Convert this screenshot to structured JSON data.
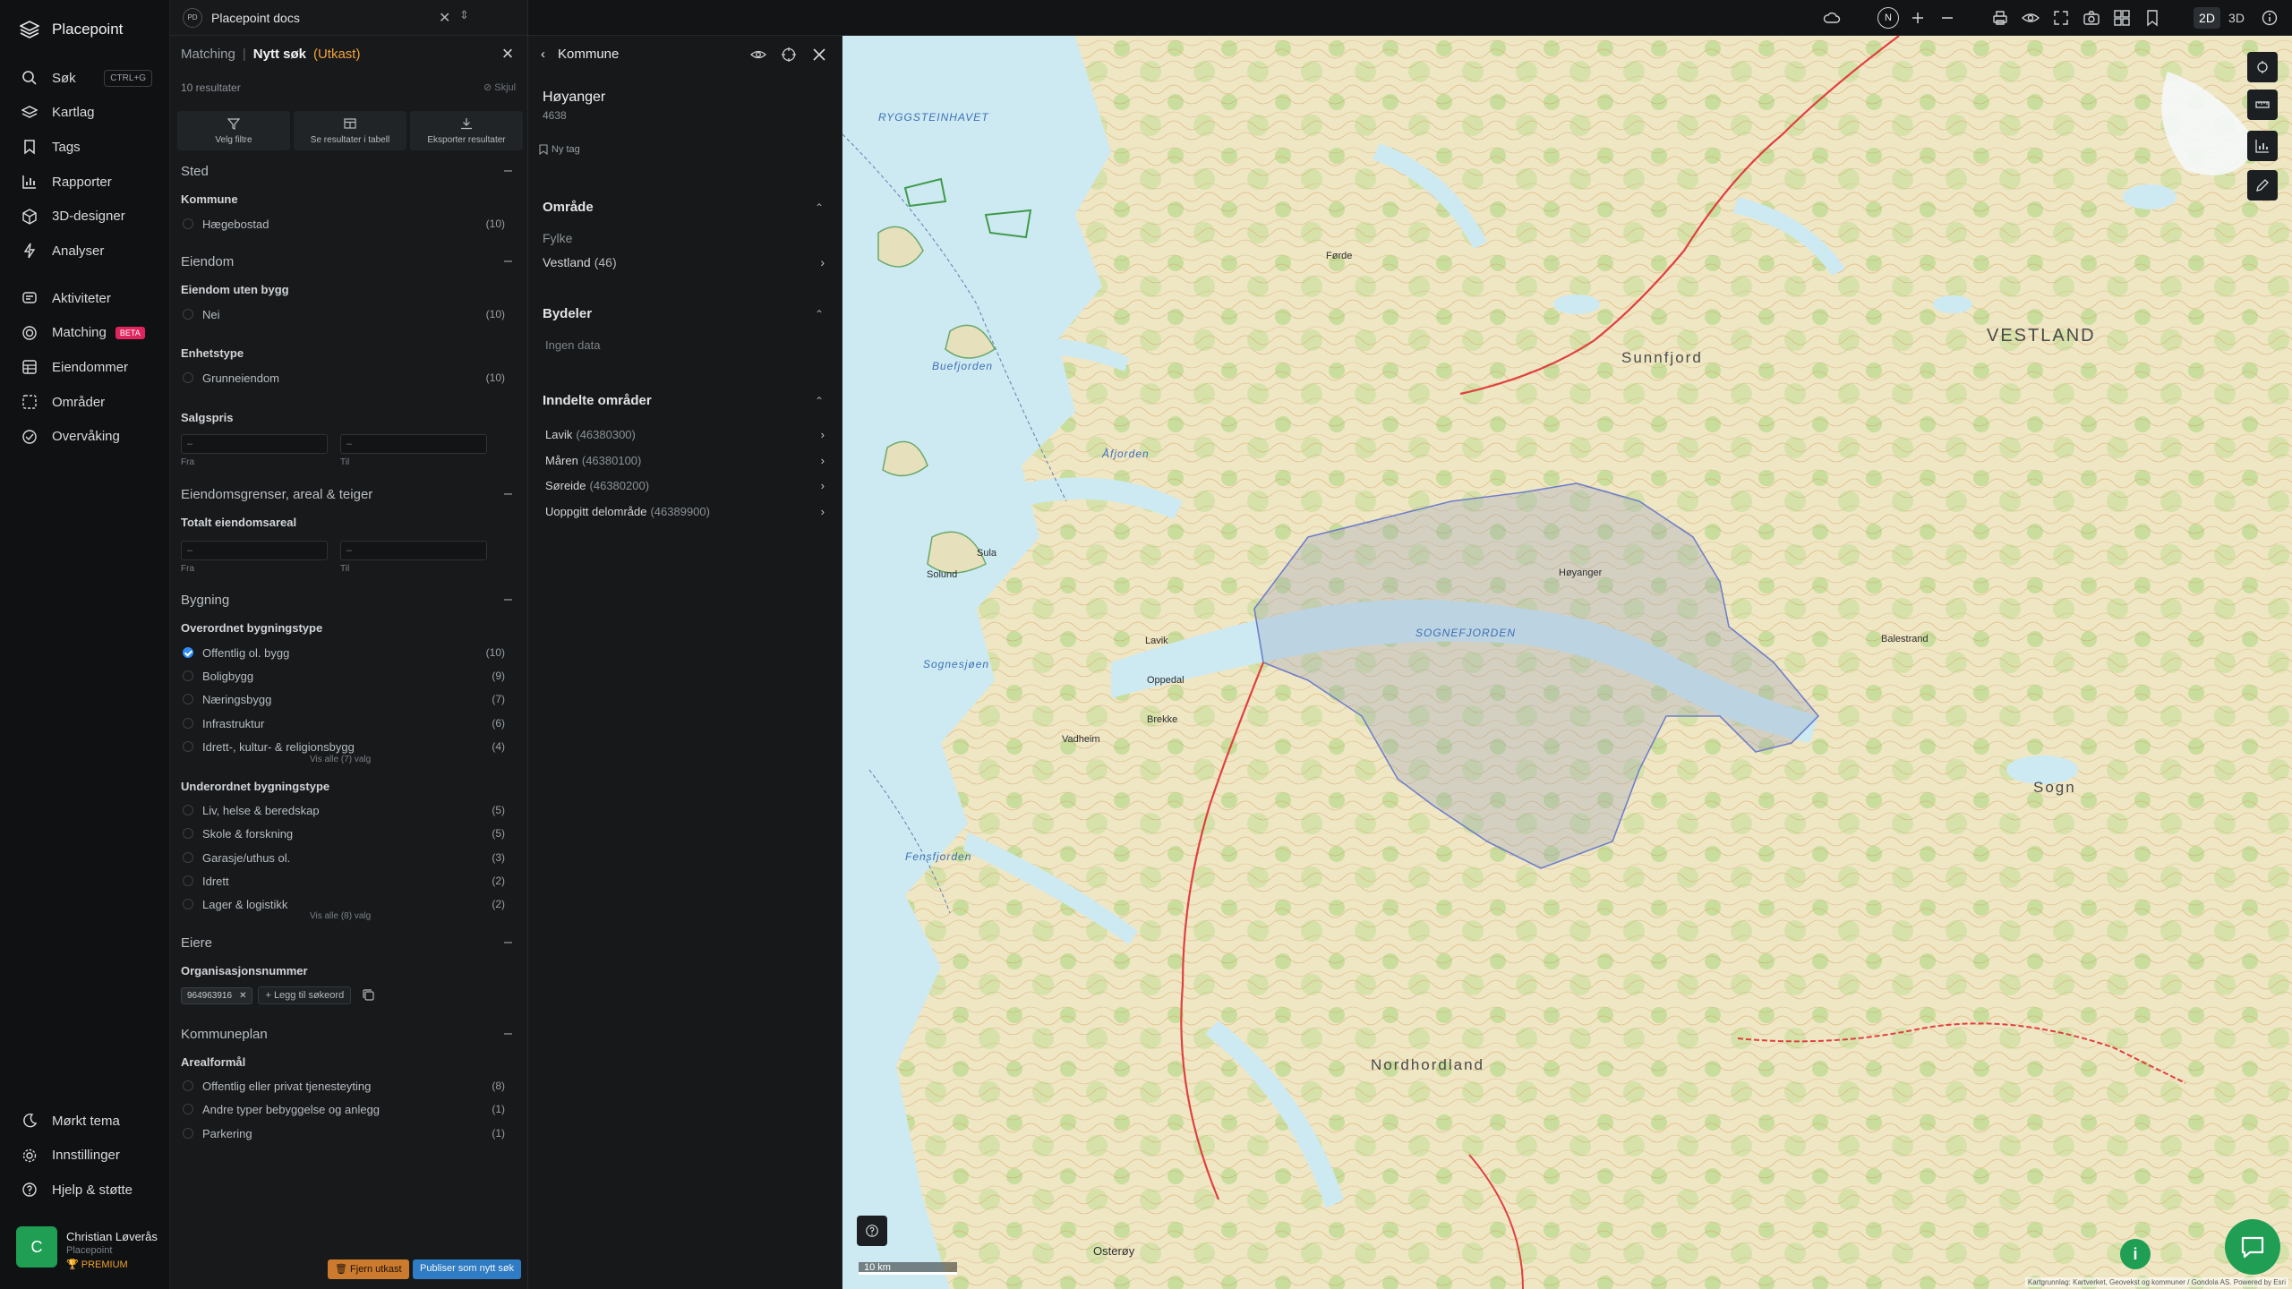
{
  "app": {
    "name": "Placepoint"
  },
  "nav": {
    "items": [
      {
        "label": "Søk",
        "icon": "search-icon",
        "shortcut": "CTRL+G"
      },
      {
        "label": "Kartlag",
        "icon": "layers-icon"
      },
      {
        "label": "Tags",
        "icon": "bookmark-icon"
      },
      {
        "label": "Rapporter",
        "icon": "chart-icon"
      },
      {
        "label": "3D-designer",
        "icon": "cube-icon"
      },
      {
        "label": "Analyser",
        "icon": "bolt-icon"
      }
    ],
    "items2": [
      {
        "label": "Aktiviteter",
        "icon": "activity-icon"
      },
      {
        "label": "Matching",
        "icon": "target-icon",
        "badge": "BETA"
      },
      {
        "label": "Eiendommer",
        "icon": "grid-icon"
      },
      {
        "label": "Områder",
        "icon": "area-icon"
      },
      {
        "label": "Overvåking",
        "icon": "monitor-icon"
      }
    ],
    "bottom": [
      {
        "label": "Mørkt tema",
        "icon": "moon-icon"
      },
      {
        "label": "Innstillinger",
        "icon": "gear-icon"
      },
      {
        "label": "Hjelp & støtte",
        "icon": "help-icon"
      }
    ],
    "user": {
      "initial": "C",
      "name": "Christian Løverås",
      "org": "Placepoint",
      "plan": "PREMIUM"
    }
  },
  "doc_tab": {
    "badge": "PD",
    "title": "Placepoint docs"
  },
  "search_panel": {
    "crumb_parent": "Matching",
    "crumb_sep": "|",
    "title": "Nytt søk",
    "state": "(Utkast)",
    "result_count": "10 resultater",
    "hide_label": "Skjul",
    "buttons": [
      "Velg filtre",
      "Se resultater i tabell",
      "Eksporter resultater"
    ],
    "sections": {
      "sted": "Sted",
      "kommune": "Kommune",
      "kommune_opts": [
        {
          "label": "Hægebostad",
          "count": "(10)"
        }
      ],
      "eiendom": "Eiendom",
      "uten_bygg": "Eiendom uten bygg",
      "uten_bygg_opts": [
        {
          "label": "Nei",
          "count": "(10)"
        }
      ],
      "enhetstype": "Enhetstype",
      "enhetstype_opts": [
        {
          "label": "Grunneiendom",
          "count": "(10)"
        }
      ],
      "salgspris": "Salgspris",
      "from_label": "Fra",
      "to_label": "Til",
      "dash": "–",
      "grenser": "Eiendomsgrenser, areal & teiger",
      "areal": "Totalt eiendomsareal",
      "bygning": "Bygning",
      "overordnet": "Overordnet bygningstype",
      "overordnet_opts": [
        {
          "label": "Offentlig ol. bygg",
          "count": "(10)",
          "checked": true
        },
        {
          "label": "Boligbygg",
          "count": "(9)"
        },
        {
          "label": "Næringsbygg",
          "count": "(7)"
        },
        {
          "label": "Infrastruktur",
          "count": "(6)"
        },
        {
          "label": "Idrett-, kultur- & religionsbygg",
          "count": "(4)"
        }
      ],
      "overordnet_more": "Vis alle (7) valg",
      "underordnet": "Underordnet bygningstype",
      "underordnet_opts": [
        {
          "label": "Liv, helse & beredskap",
          "count": "(5)"
        },
        {
          "label": "Skole & forskning",
          "count": "(5)"
        },
        {
          "label": "Garasje/uthus ol.",
          "count": "(3)"
        },
        {
          "label": "Idrett",
          "count": "(2)"
        },
        {
          "label": "Lager & logistikk",
          "count": "(2)"
        }
      ],
      "underordnet_more": "Vis alle (8) valg",
      "eiere": "Eiere",
      "orgnr": "Organisasjonsnummer",
      "orgnr_value": "964963916",
      "add_keyword": "Legg til søkeord",
      "kommuneplan": "Kommuneplan",
      "arealformal": "Arealformål",
      "arealformal_opts": [
        {
          "label": "Offentlig eller privat tjenesteyting",
          "count": "(8)"
        },
        {
          "label": "Andre typer bebyggelse og anlegg",
          "count": "(1)"
        },
        {
          "label": "Parkering",
          "count": "(1)"
        }
      ]
    },
    "remove_draft": "Fjern utkast",
    "publish": "Publiser som nytt søk"
  },
  "kommune_panel": {
    "title": "Kommune",
    "name": "Høyanger",
    "code": "4638",
    "new_tag": "Ny tag",
    "omrade": "Område",
    "fylke_label": "Fylke",
    "fylke_value": "Vestland",
    "fylke_count": "(46)",
    "bydeler": "Bydeler",
    "no_data": "Ingen data",
    "inndelte": "Inndelte områder",
    "areas": [
      {
        "name": "Lavik",
        "id": "(46380300)"
      },
      {
        "name": "Måren",
        "id": "(46380100)"
      },
      {
        "name": "Søreide",
        "id": "(46380200)"
      },
      {
        "name": "Uoppgitt delområde",
        "id": "(46389900)"
      }
    ]
  },
  "toolbar": {
    "compass": "N",
    "mode_2d": "2D",
    "mode_3d": "3D"
  },
  "map": {
    "labels": {
      "vestland": "VESTLAND",
      "sunnfjord": "Sunnfjord",
      "sogn": "Sogn",
      "nordhordland": "Nordhordland",
      "ryggsteinhavet": "RYGGSTEINHAVET",
      "sognefjorden": "SOGNEFJORDEN",
      "sognesjoen": "Sognesjøen",
      "fensfjorden": "Fensfjorden",
      "afjorden": "Åfjorden",
      "buefjorden": "Buefjorden",
      "hoyanger": "Høyanger",
      "lavik": "Lavik",
      "balestrand": "Balestrand",
      "brekke": "Brekke",
      "sula": "Sula",
      "solund": "Solund",
      "forde": "Førde",
      "vadheim": "Vadheim",
      "oppedal": "Oppedal",
      "ostereoy": "Osterøy"
    },
    "scale": "10 km",
    "attribution": "Kartgrunnlag: Kartverket, Geovekst og kommuner / Gondola AS. Powered by Esri"
  }
}
